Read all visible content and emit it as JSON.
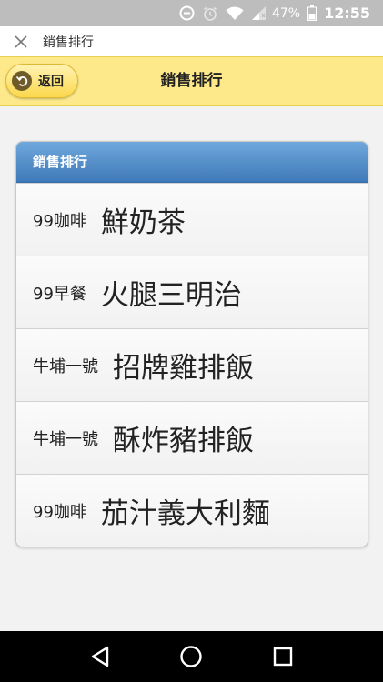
{
  "status_bar": {
    "battery": "47%",
    "time": "12:55",
    "icons": [
      "data-saver-icon",
      "alarm-icon",
      "wifi-icon",
      "signal-icon",
      "battery-icon"
    ]
  },
  "webview": {
    "title": "銷售排行",
    "close_icon": "close-icon"
  },
  "header": {
    "back_label": "返回",
    "title": "銷售排行"
  },
  "list": {
    "divider": "銷售排行",
    "items": [
      {
        "shop": "99咖啡",
        "dish": "鮮奶茶"
      },
      {
        "shop": "99早餐",
        "dish": "火腿三明治"
      },
      {
        "shop": "牛埔一號",
        "dish": "招牌雞排飯"
      },
      {
        "shop": "牛埔一號",
        "dish": "酥炸豬排飯"
      },
      {
        "shop": "99咖啡",
        "dish": "茄汁義大利麵"
      }
    ]
  },
  "nav_bar": {
    "buttons": [
      "back-icon",
      "home-icon",
      "recents-icon"
    ]
  },
  "colors": {
    "header_bg": "#fde98a",
    "divider_top": "#6fa8dc",
    "divider_bottom": "#3f79b8",
    "status_bar": "#bdbdbd"
  }
}
